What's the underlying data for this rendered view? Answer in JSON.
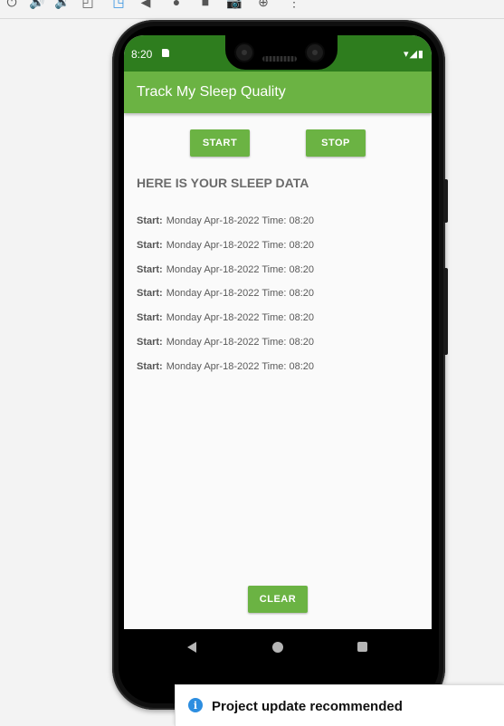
{
  "toolbar": {
    "icons": [
      "power-icon",
      "volume-up-icon",
      "volume-down-icon",
      "rotate-left-icon",
      "rotate-right-icon",
      "back-icon",
      "home-icon",
      "overview-icon",
      "camera-icon",
      "zoom-icon",
      "more-icon"
    ]
  },
  "status": {
    "time": "8:20"
  },
  "app": {
    "title": "Track My Sleep Quality",
    "start_label": "START",
    "stop_label": "STOP",
    "heading": "HERE IS YOUR SLEEP DATA",
    "clear_label": "CLEAR",
    "entries": [
      {
        "label": "Start:",
        "value": "Monday Apr-18-2022 Time: 08:20"
      },
      {
        "label": "Start:",
        "value": "Monday Apr-18-2022 Time: 08:20"
      },
      {
        "label": "Start:",
        "value": "Monday Apr-18-2022 Time: 08:20"
      },
      {
        "label": "Start:",
        "value": "Monday Apr-18-2022 Time: 08:20"
      },
      {
        "label": "Start:",
        "value": "Monday Apr-18-2022 Time: 08:20"
      },
      {
        "label": "Start:",
        "value": "Monday Apr-18-2022 Time: 08:20"
      },
      {
        "label": "Start:",
        "value": "Monday Apr-18-2022 Time: 08:20"
      }
    ]
  },
  "notification": {
    "text": "Project update recommended"
  },
  "colors": {
    "accent": "#6bb343",
    "statusbar": "#2e7d1e",
    "info": "#2d8ee0"
  }
}
